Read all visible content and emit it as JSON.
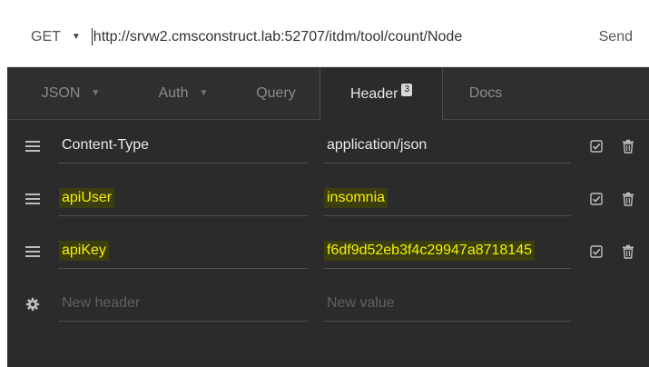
{
  "request": {
    "method": "GET",
    "url": "http://srvw2.cmsconstruct.lab:52707/itdm/tool/count/Node",
    "send_label": "Send"
  },
  "tabs": [
    {
      "label": "JSON",
      "has_dropdown": true
    },
    {
      "label": "Auth",
      "has_dropdown": true
    },
    {
      "label": "Query"
    },
    {
      "label": "Header",
      "badge": "3",
      "active": true
    },
    {
      "label": "Docs"
    }
  ],
  "headers": [
    {
      "name": "Content-Type",
      "value": "application/json",
      "highlighted": false,
      "enabled": true
    },
    {
      "name": "apiUser",
      "value": "insomnia",
      "highlighted": true,
      "enabled": true
    },
    {
      "name": "apiKey",
      "value": "f6df9d52eb3f4c29947a8718145",
      "highlighted": true,
      "enabled": true
    }
  ],
  "new_header": {
    "name_placeholder": "New header",
    "value_placeholder": "New value"
  },
  "icons": {
    "drag": "drag-handle-icon",
    "checkbox": "checkbox-checked-icon",
    "delete": "trash-icon",
    "settings": "gear-icon"
  },
  "colors": {
    "background": "#2b2b2b",
    "highlight_text": "#f2f200",
    "highlight_bg": "#3d3d12"
  }
}
